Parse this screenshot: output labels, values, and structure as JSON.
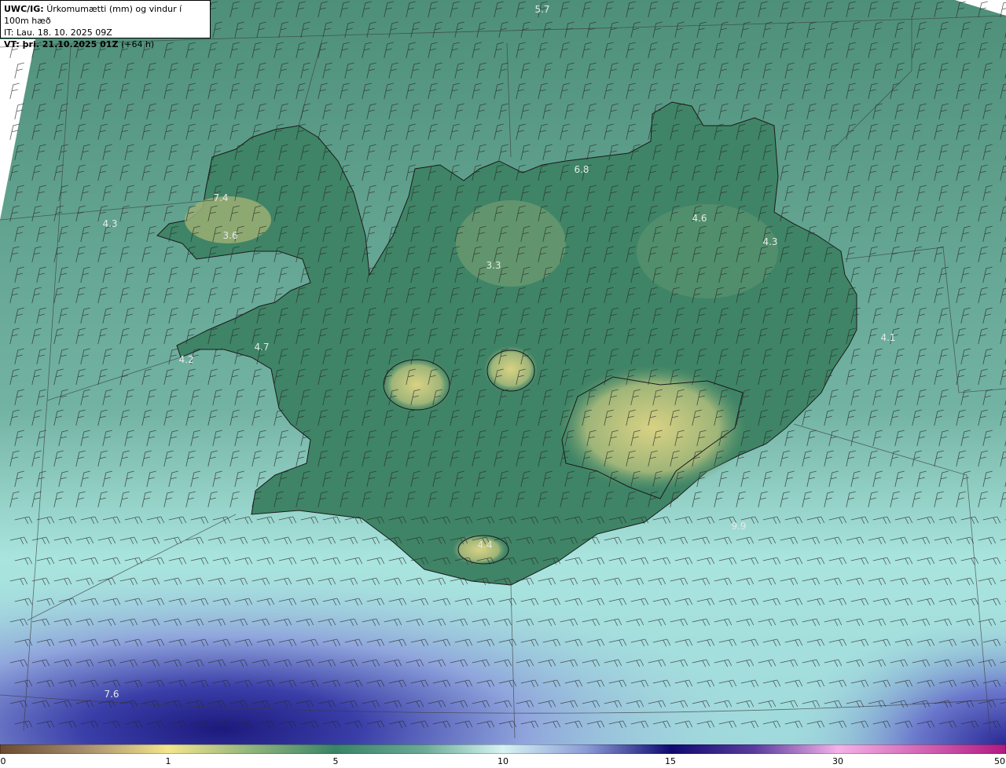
{
  "header": {
    "model": "UWC/IG:",
    "title": "Úrkomumætti (mm) og vindur í 100m hæð",
    "init_time": "IT: Lau. 18. 10. 2025 09Z",
    "valid_label": "VT: þri. 21.10.2025 01Z",
    "valid_offset": "(+64 h)"
  },
  "map_values": [
    "5.7",
    "7.4",
    "3.6",
    "3.3",
    "4.6",
    "4.3",
    "4.7",
    "4.2",
    "4.4",
    "4.3",
    "6.8",
    "4.1",
    "9.9",
    "7.6"
  ],
  "colorbar": {
    "ticks": [
      "0",
      "1",
      "5",
      "10",
      "15",
      "30",
      "50"
    ]
  },
  "colors": {
    "land_low": "#3f8466",
    "land_high": "#d5d17c",
    "sea": "#5f9c88",
    "sea_light": "#a6e6e0",
    "deep_blue": "#1b1a80"
  }
}
